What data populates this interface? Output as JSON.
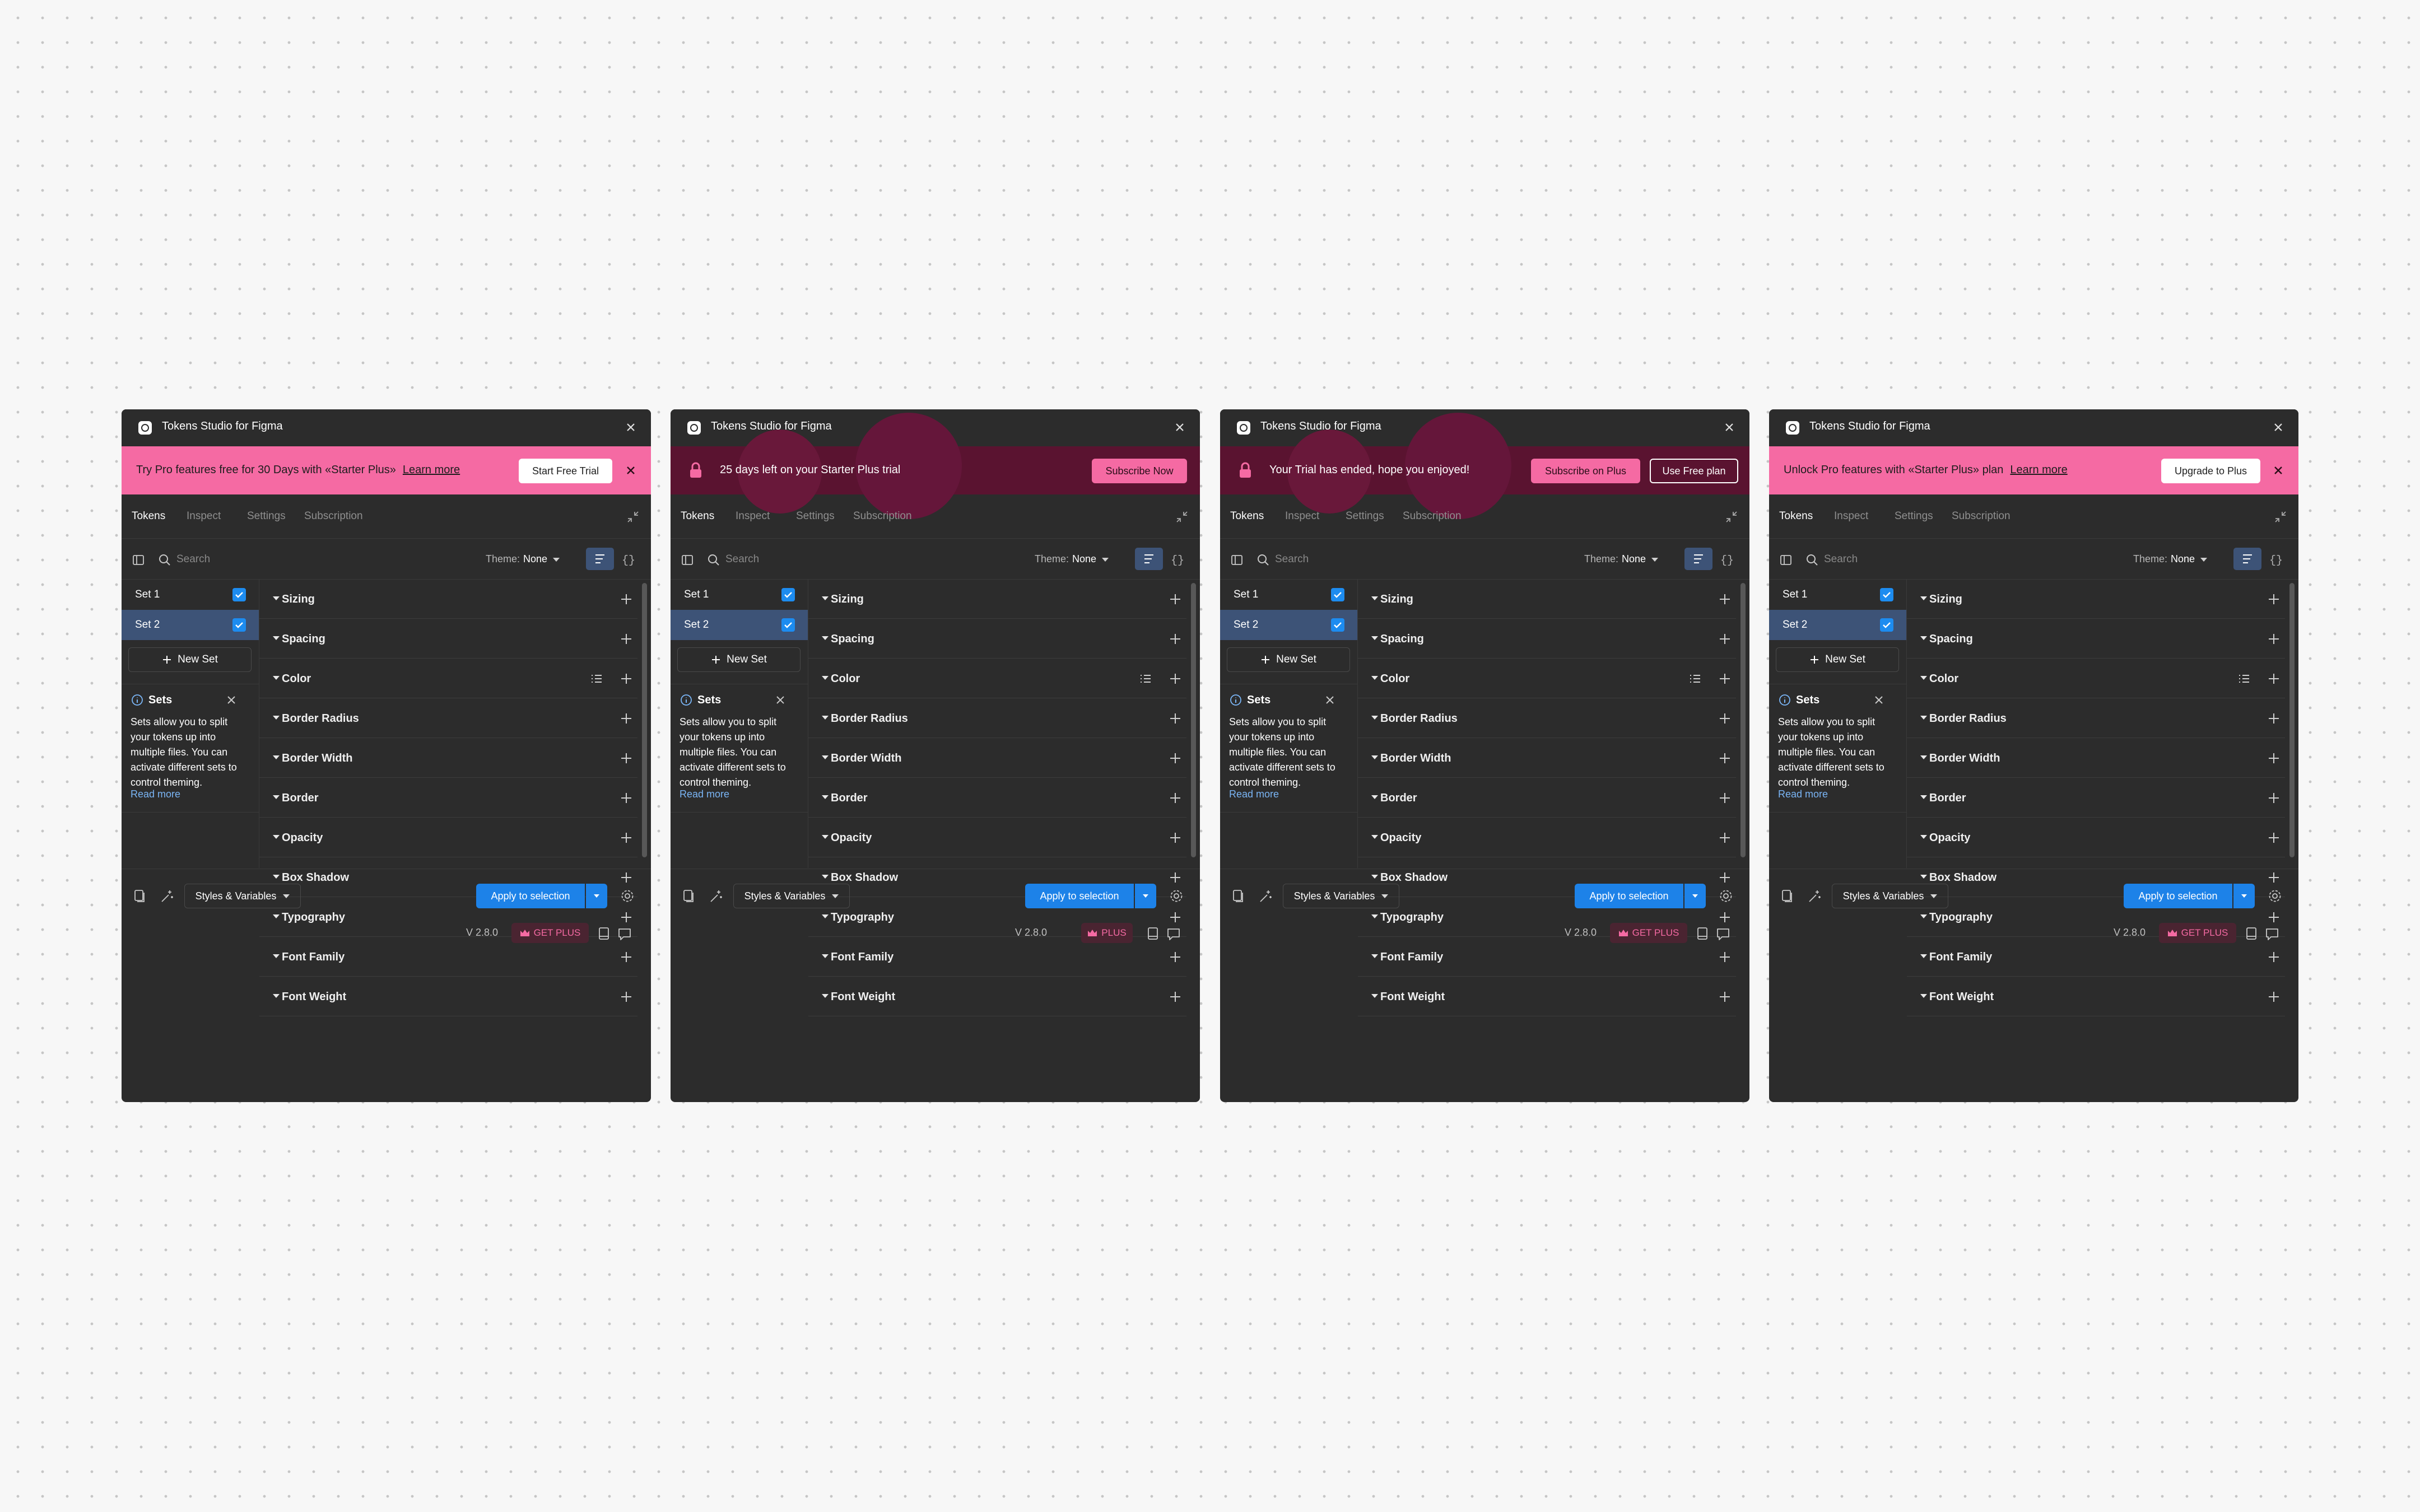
{
  "colors": {
    "canvas": "#f7f7f7",
    "panel": "#2c2c2c",
    "banner_pink": "#f56aa3",
    "banner_dark": "#5a1330",
    "accent_blue": "#1d82e8",
    "selected_row": "#3d5377",
    "link": "#7ab5f5"
  },
  "panels": [
    {
      "title": "Tokens Studio for Figma",
      "banner": {
        "text": "Try Pro features free for 30 Days with «Starter Plus»",
        "link": "Learn more",
        "button1": "Start Free Trial",
        "button2": ""
      },
      "tabs": [
        "Tokens",
        "Inspect",
        "Settings",
        "Subscription"
      ],
      "search": {
        "placeholder": "Search"
      },
      "theme": {
        "label": "Theme:",
        "value": "None"
      },
      "sets": [
        {
          "label": "Set 1",
          "checked": true
        },
        {
          "label": "Set 2",
          "checked": true
        }
      ],
      "new_set_label": "New Set",
      "info": {
        "title": "Sets",
        "body": "Sets allow you to split your tokens up into multiple files. You can activate different sets to control theming.",
        "link": "Read more"
      },
      "groups": [
        "Sizing",
        "Spacing",
        "Color",
        "Border Radius",
        "Border Width",
        "Border",
        "Opacity",
        "Box Shadow",
        "Typography",
        "Font Family",
        "Font Weight"
      ],
      "footer": {
        "styles_label": "Styles & Variables",
        "apply_label": "Apply to selection",
        "version": "V 2.8.0",
        "plan_badge": "GET PLUS"
      }
    },
    {
      "title": "Tokens Studio for Figma",
      "banner": {
        "text": "25 days left on your Starter Plus trial",
        "link": "",
        "button1": "Subscribe Now",
        "button2": ""
      },
      "tabs": [
        "Tokens",
        "Inspect",
        "Settings",
        "Subscription"
      ],
      "search": {
        "placeholder": "Search"
      },
      "theme": {
        "label": "Theme:",
        "value": "None"
      },
      "sets": [
        {
          "label": "Set 1",
          "checked": true
        },
        {
          "label": "Set 2",
          "checked": true
        }
      ],
      "new_set_label": "New Set",
      "info": {
        "title": "Sets",
        "body": "Sets allow you to split your tokens up into multiple files. You can activate different sets to control theming.",
        "link": "Read more"
      },
      "groups": [
        "Sizing",
        "Spacing",
        "Color",
        "Border Radius",
        "Border Width",
        "Border",
        "Opacity",
        "Box Shadow",
        "Typography",
        "Font Family",
        "Font Weight"
      ],
      "footer": {
        "styles_label": "Styles & Variables",
        "apply_label": "Apply to selection",
        "version": "V 2.8.0",
        "plan_badge": "PLUS"
      }
    },
    {
      "title": "Tokens Studio for Figma",
      "banner": {
        "text": "Your Trial has ended, hope you enjoyed!",
        "link": "",
        "button1": "Subscribe on Plus",
        "button2": "Use Free plan"
      },
      "tabs": [
        "Tokens",
        "Inspect",
        "Settings",
        "Subscription"
      ],
      "search": {
        "placeholder": "Search"
      },
      "theme": {
        "label": "Theme:",
        "value": "None"
      },
      "sets": [
        {
          "label": "Set 1",
          "checked": true
        },
        {
          "label": "Set 2",
          "checked": true
        }
      ],
      "new_set_label": "New Set",
      "info": {
        "title": "Sets",
        "body": "Sets allow you to split your tokens up into multiple files. You can activate different sets to control theming.",
        "link": "Read more"
      },
      "groups": [
        "Sizing",
        "Spacing",
        "Color",
        "Border Radius",
        "Border Width",
        "Border",
        "Opacity",
        "Box Shadow",
        "Typography",
        "Font Family",
        "Font Weight"
      ],
      "footer": {
        "styles_label": "Styles & Variables",
        "apply_label": "Apply to selection",
        "version": "V 2.8.0",
        "plan_badge": "GET PLUS"
      }
    },
    {
      "title": "Tokens Studio for Figma",
      "banner": {
        "text": "Unlock Pro features with «Starter Plus» plan",
        "link": "Learn more",
        "button1": "Upgrade to Plus",
        "button2": ""
      },
      "tabs": [
        "Tokens",
        "Inspect",
        "Settings",
        "Subscription"
      ],
      "search": {
        "placeholder": "Search"
      },
      "theme": {
        "label": "Theme:",
        "value": "None"
      },
      "sets": [
        {
          "label": "Set 1",
          "checked": true
        },
        {
          "label": "Set 2",
          "checked": true
        }
      ],
      "new_set_label": "New Set",
      "info": {
        "title": "Sets",
        "body": "Sets allow you to split your tokens up into multiple files. You can activate different sets to control theming.",
        "link": "Read more"
      },
      "groups": [
        "Sizing",
        "Spacing",
        "Color",
        "Border Radius",
        "Border Width",
        "Border",
        "Opacity",
        "Box Shadow",
        "Typography",
        "Font Family",
        "Font Weight"
      ],
      "footer": {
        "styles_label": "Styles & Variables",
        "apply_label": "Apply to selection",
        "version": "V 2.8.0",
        "plan_badge": "GET PLUS"
      }
    }
  ]
}
